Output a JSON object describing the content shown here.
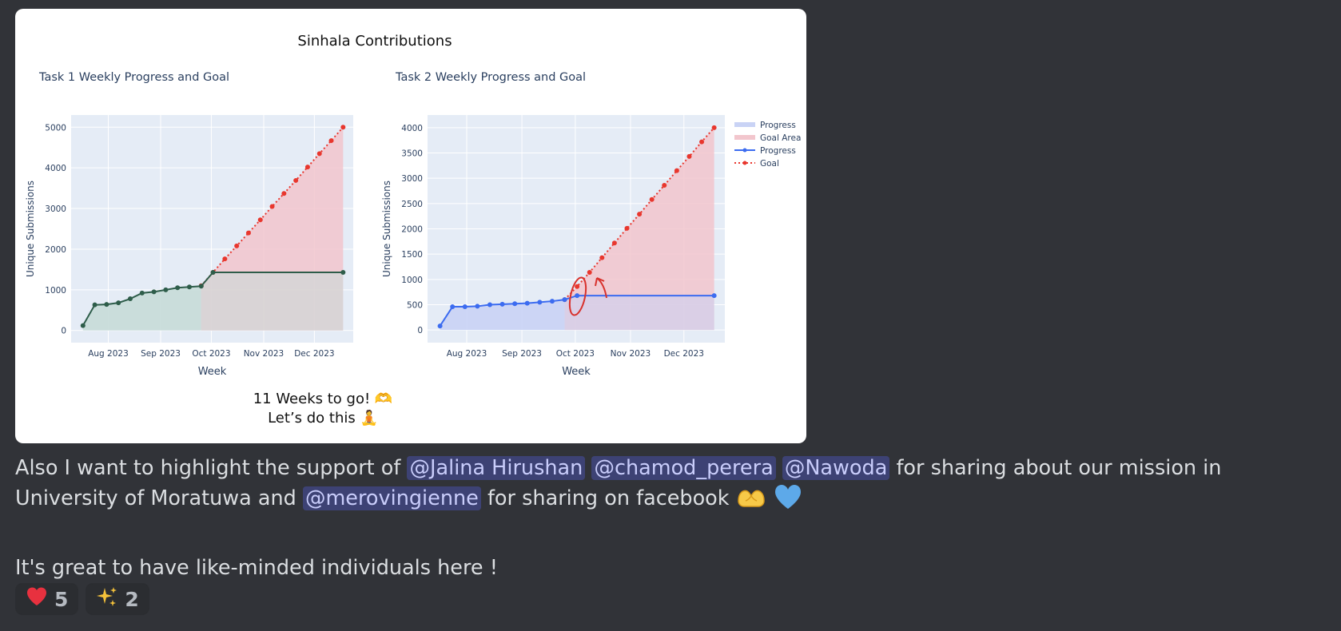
{
  "image": {
    "main_title": "Sinhala Contributions",
    "footer_line1": "11 Weeks to go! 🫶",
    "footer_line2": "Let’s do this 🧘"
  },
  "chart_data": [
    {
      "type": "line",
      "title": "Task 1 Weekly Progress and Goal",
      "xlabel": "Week",
      "ylabel": "Unique Submissions",
      "x_ticks": [
        "Aug 2023",
        "Sep 2023",
        "Oct 2023",
        "Nov 2023",
        "Dec 2023"
      ],
      "y_ticks": [
        0,
        1000,
        2000,
        3000,
        4000,
        5000
      ],
      "ylim": [
        -300,
        5300
      ],
      "grid": true,
      "colors": {
        "progress": "#2e5d4a",
        "goal": "#e8372e",
        "progress_area": "#c7dcd8",
        "goal_area": "#f2c6cd",
        "plot_bg": "#e5ecf6"
      },
      "series": [
        {
          "name": "Progress",
          "x": [
            "2023-07-17",
            "2023-07-24",
            "2023-07-31",
            "2023-08-07",
            "2023-08-14",
            "2023-08-21",
            "2023-08-28",
            "2023-09-04",
            "2023-09-11",
            "2023-09-18",
            "2023-09-25",
            "2023-10-02",
            "2023-12-18"
          ],
          "values": [
            120,
            630,
            640,
            680,
            780,
            920,
            950,
            1000,
            1050,
            1070,
            1090,
            1430,
            1430
          ]
        },
        {
          "name": "Goal",
          "x": [
            "2023-09-25",
            "2023-10-02",
            "2023-10-09",
            "2023-10-16",
            "2023-10-23",
            "2023-10-30",
            "2023-11-06",
            "2023-11-13",
            "2023-11-20",
            "2023-11-27",
            "2023-12-04",
            "2023-12-11",
            "2023-12-18"
          ],
          "values": [
            1100,
            1430,
            1760,
            2080,
            2400,
            2720,
            3050,
            3370,
            3690,
            4020,
            4350,
            4670,
            5000
          ]
        }
      ]
    },
    {
      "type": "line",
      "title": "Task 2 Weekly Progress and Goal",
      "xlabel": "Week",
      "ylabel": "Unique Submissions",
      "x_ticks": [
        "Aug 2023",
        "Sep 2023",
        "Oct 2023",
        "Nov 2023",
        "Dec 2023"
      ],
      "y_ticks": [
        0,
        500,
        1000,
        1500,
        2000,
        2500,
        3000,
        3500,
        4000
      ],
      "ylim": [
        -250,
        4250
      ],
      "grid": true,
      "legend": [
        "Progress",
        "Goal Area",
        "Progress",
        "Goal"
      ],
      "legend_position": "top-right",
      "colors": {
        "progress": "#3c6cf0",
        "goal": "#e8372e",
        "progress_area": "#c9d3f5",
        "goal_area": "#f2c6cd",
        "plot_bg": "#e5ecf6"
      },
      "series": [
        {
          "name": "Progress",
          "x": [
            "2023-07-17",
            "2023-07-24",
            "2023-07-31",
            "2023-08-07",
            "2023-08-14",
            "2023-08-21",
            "2023-08-28",
            "2023-09-04",
            "2023-09-11",
            "2023-09-18",
            "2023-09-25",
            "2023-10-02",
            "2023-12-18"
          ],
          "values": [
            80,
            460,
            460,
            470,
            500,
            510,
            520,
            530,
            550,
            570,
            600,
            680,
            680
          ]
        },
        {
          "name": "Goal",
          "x": [
            "2023-09-25",
            "2023-10-02",
            "2023-10-09",
            "2023-10-16",
            "2023-10-23",
            "2023-10-30",
            "2023-11-06",
            "2023-11-13",
            "2023-11-20",
            "2023-11-27",
            "2023-12-04",
            "2023-12-11",
            "2023-12-18"
          ],
          "values": [
            600,
            860,
            1140,
            1430,
            1720,
            2010,
            2290,
            2580,
            2860,
            3150,
            3430,
            3720,
            4000
          ]
        }
      ]
    }
  ],
  "message": {
    "text1": "Also I want to highlight the support of",
    "mention1": "@Jalina Hirushan",
    "mention2": "@chamod_perera",
    "mention3": "@Nawoda",
    "text2": "for sharing about our mission in University of Moratuwa and",
    "mention4": "@merovingienne",
    "text3": "for sharing on facebook",
    "line2": "It's great to have like-minded individuals here !"
  },
  "reactions": [
    {
      "emoji": "heart-icon",
      "count": "5",
      "color": "#e8313f"
    },
    {
      "emoji": "sparkles-icon",
      "count": "2",
      "color": "#f4c13a"
    }
  ]
}
